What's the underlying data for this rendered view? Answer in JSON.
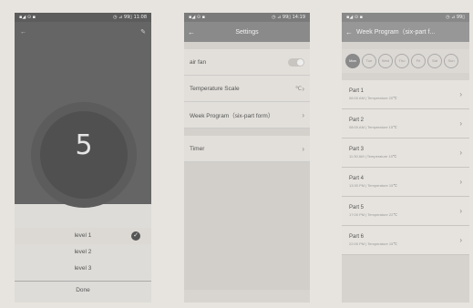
{
  "screen1": {
    "statusbar": {
      "left": "▪︎◢ ⊙ ▪",
      "right": "◷ ⊿ 99▯ 11:08"
    },
    "title": "",
    "subtitle": "",
    "dial": {
      "value": "5",
      "label1": "",
      "label2": ""
    },
    "sheet": {
      "title": "",
      "options": [
        {
          "label": "level 1",
          "selected": true
        },
        {
          "label": "level 2",
          "selected": false
        },
        {
          "label": "level 3",
          "selected": false
        }
      ],
      "done": "Done"
    }
  },
  "screen2": {
    "statusbar": {
      "left": "▪︎◢ ⊙ ▪",
      "right": "◷ ⊿ 99▯ 14:19"
    },
    "title": "Settings",
    "rows": [
      {
        "label": "air fan",
        "control": "toggle"
      },
      {
        "label": "Temperature Scale",
        "value": "℃"
      },
      {
        "label": "Week Program（six-part form）"
      },
      {
        "label": "Timer"
      }
    ]
  },
  "screen3": {
    "statusbar": {
      "left": "▪︎◢ ⊙ ▪",
      "right": "◷ ⊿ 99▯"
    },
    "title": "Week Program（six-part f...",
    "days": [
      "Mon",
      "Tue",
      "Wed",
      "Thu",
      "Fri",
      "Sat",
      "Sun"
    ],
    "active_day": "Mon",
    "parts": [
      {
        "name": "Part 1",
        "detail": "06:00 AM | Temperature 20℃"
      },
      {
        "name": "Part 2",
        "detail": "08:00 AM | Temperature 15℃"
      },
      {
        "name": "Part 3",
        "detail": "11:30 AM | Temperature 15℃"
      },
      {
        "name": "Part 4",
        "detail": "13:30 PM | Temperature 15℃"
      },
      {
        "name": "Part 5",
        "detail": "17:00 PM | Temperature 22℃"
      },
      {
        "name": "Part 6",
        "detail": "22:00 PM | Temperature 15℃"
      }
    ]
  },
  "icons": {
    "back": "back-arrow-icon",
    "chevron": "chevron-right-icon",
    "check": "check-icon"
  }
}
